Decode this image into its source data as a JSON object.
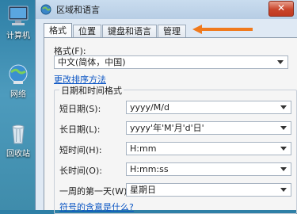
{
  "desktop": {
    "icons": [
      {
        "label": "计算机"
      },
      {
        "label": "网络"
      },
      {
        "label": "回收站"
      }
    ]
  },
  "window": {
    "title": "区域和语言",
    "close_label": "✕",
    "tabs": [
      {
        "label": "格式"
      },
      {
        "label": "位置"
      },
      {
        "label": "键盘和语言"
      },
      {
        "label": "管理"
      }
    ],
    "format_label": "格式(F):",
    "format_value": "中文(简体，中国)",
    "sort_link": "更改排序方法",
    "group_title": "日期和时间格式",
    "rows": [
      {
        "label": "短日期(S):",
        "value": "yyyy/M/d"
      },
      {
        "label": "长日期(L):",
        "value": "yyyy'年'M'月'd'日'"
      },
      {
        "label": "短时间(H):",
        "value": "H:mm"
      },
      {
        "label": "长时间(O):",
        "value": "H:mm:ss"
      },
      {
        "label": "一周的第一天(W):",
        "value": "星期日"
      }
    ],
    "symbols_link": "符号的含意是什么?"
  },
  "annotation": {
    "color": "#f07a1d"
  }
}
